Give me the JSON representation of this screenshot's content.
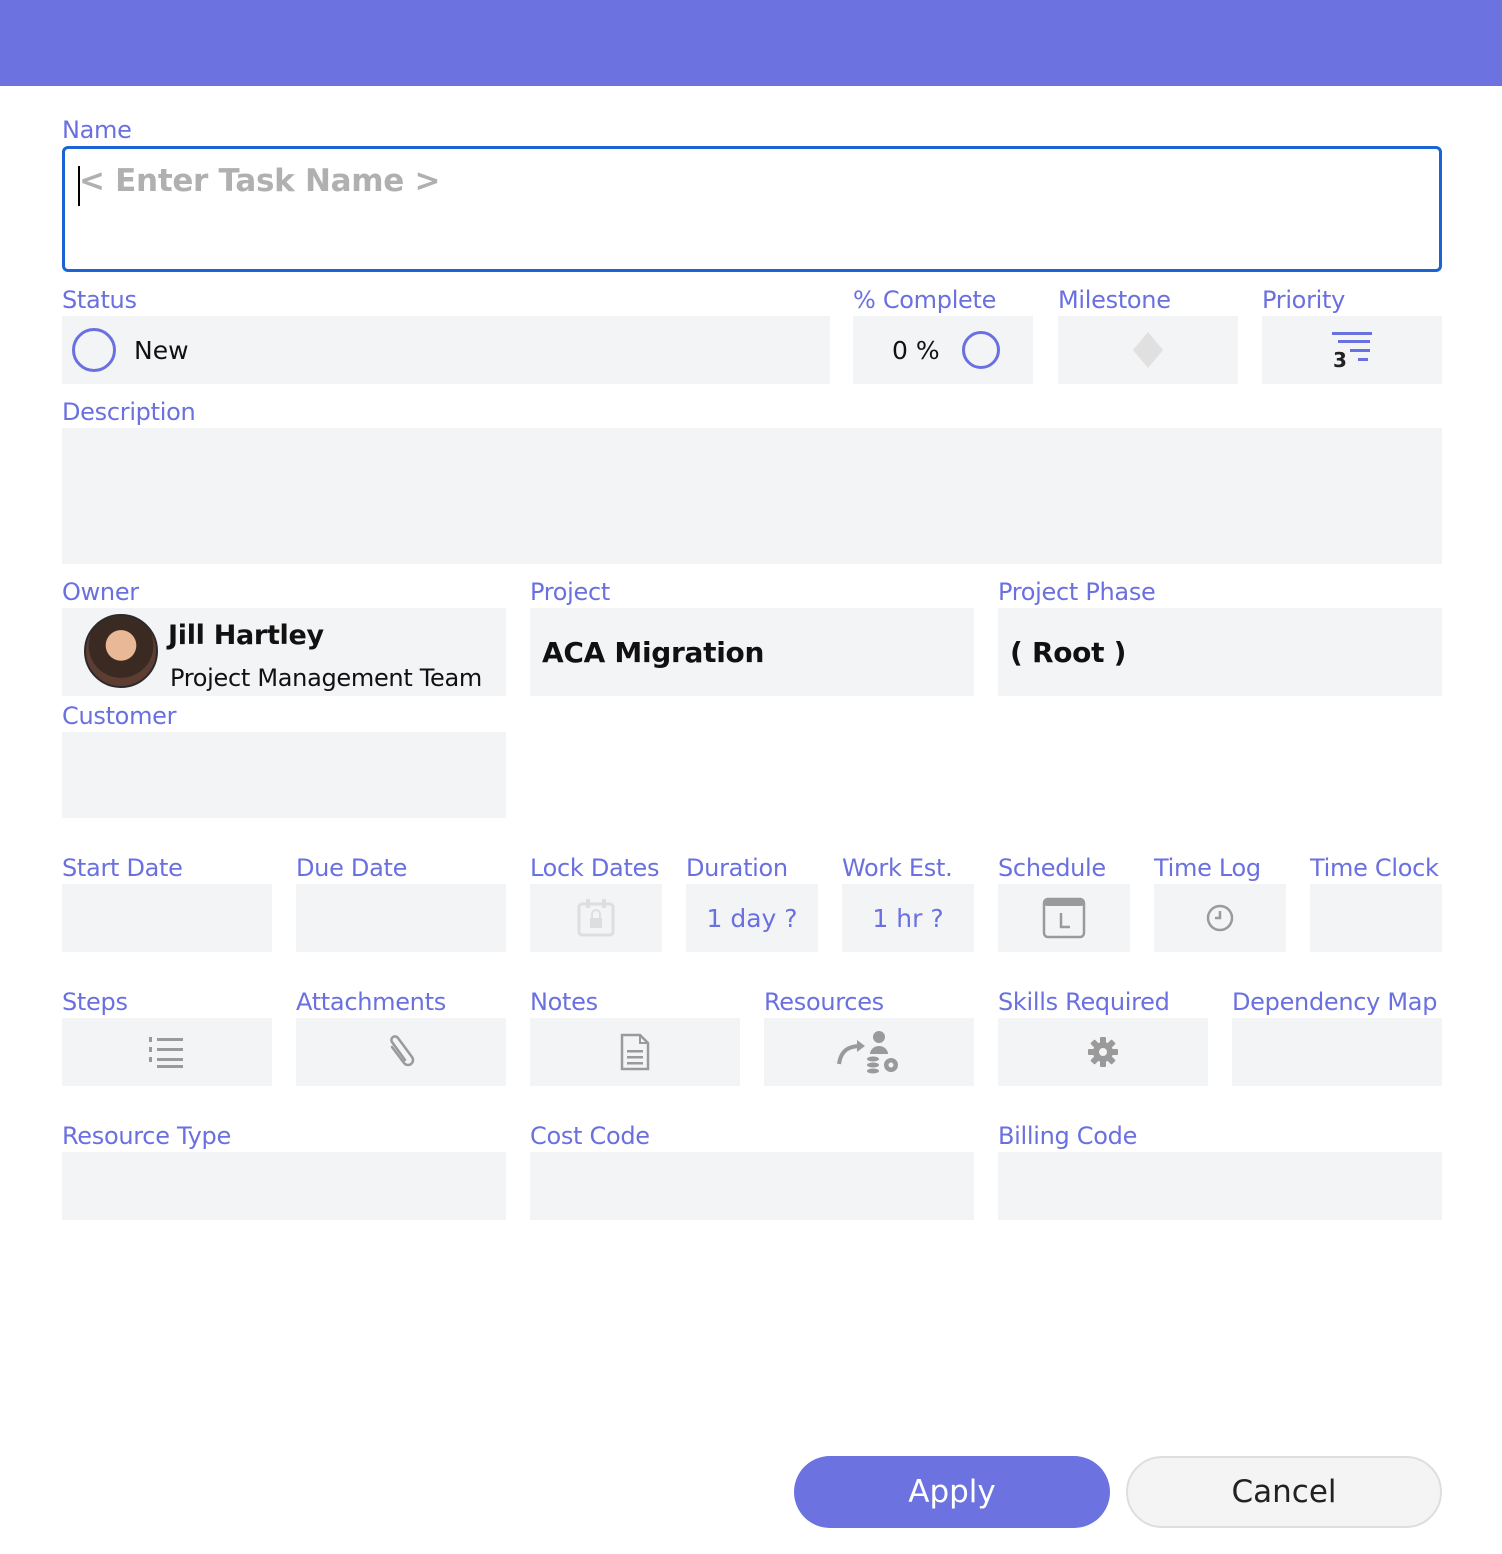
{
  "dialog": {
    "name": {
      "label": "Name",
      "placeholder": "< Enter Task Name >"
    },
    "status": {
      "label": "Status",
      "value": "New"
    },
    "percent_complete": {
      "label": "% Complete",
      "value": "0 %"
    },
    "milestone": {
      "label": "Milestone"
    },
    "priority": {
      "label": "Priority",
      "value": "3"
    },
    "description": {
      "label": "Description",
      "value": ""
    },
    "owner": {
      "label": "Owner",
      "name": "Jill Hartley",
      "team": "Project Management Team"
    },
    "project": {
      "label": "Project",
      "value": "ACA Migration"
    },
    "project_phase": {
      "label": "Project Phase",
      "value": "( Root )"
    },
    "customer": {
      "label": "Customer",
      "value": ""
    },
    "start_date": {
      "label": "Start Date",
      "value": ""
    },
    "due_date": {
      "label": "Due Date",
      "value": ""
    },
    "lock_dates": {
      "label": "Lock Dates"
    },
    "duration": {
      "label": "Duration",
      "value": "1 day ?"
    },
    "work_est": {
      "label": "Work Est.",
      "value": "1 hr ?"
    },
    "schedule": {
      "label": "Schedule"
    },
    "time_log": {
      "label": "Time Log"
    },
    "time_clock": {
      "label": "Time Clock"
    },
    "steps": {
      "label": "Steps"
    },
    "attachments": {
      "label": "Attachments"
    },
    "notes": {
      "label": "Notes"
    },
    "resources": {
      "label": "Resources"
    },
    "skills_required": {
      "label": "Skills Required"
    },
    "dependency_map": {
      "label": "Dependency Map"
    },
    "resource_type": {
      "label": "Resource Type",
      "value": ""
    },
    "cost_code": {
      "label": "Cost Code",
      "value": ""
    },
    "billing_code": {
      "label": "Billing Code",
      "value": ""
    },
    "buttons": {
      "apply": "Apply",
      "cancel": "Cancel"
    }
  },
  "colors": {
    "accent": "#6c73e0",
    "field_bg": "#f3f4f6",
    "focus_border": "#1c63d6",
    "icon_gray": "#b5b5b5"
  },
  "icons": [
    "status-ring-icon",
    "progress-ring-icon",
    "milestone-diamond-icon",
    "priority-icon",
    "lock-calendar-icon",
    "schedule-calendar-icon",
    "clock-icon",
    "steps-list-icon",
    "paperclip-icon",
    "notes-document-icon",
    "resources-icon",
    "gear-icon"
  ]
}
